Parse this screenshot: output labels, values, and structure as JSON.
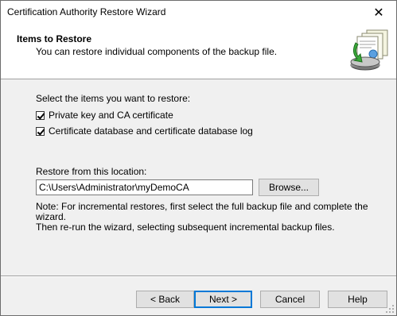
{
  "window": {
    "title": "Certification Authority Restore Wizard",
    "close_glyph": "✕"
  },
  "header": {
    "title": "Items to Restore",
    "subtitle": "You can restore individual components of the backup file.",
    "icon": "certificate-restore-icon"
  },
  "content": {
    "prompt": "Select the items you want to restore:",
    "items": [
      {
        "label": "Private key and CA certificate",
        "checked": true
      },
      {
        "label": "Certificate database and certificate database log",
        "checked": true
      }
    ],
    "location_label": "Restore from this location:",
    "location_value": "C:\\Users\\Administrator\\myDemoCA",
    "browse_label": "Browse...",
    "note_line1": "Note: For incremental restores, first select the full backup file and complete the wizard.",
    "note_line2": "Then re-run the wizard, selecting subsequent incremental backup files."
  },
  "buttons": {
    "back": "< Back",
    "next": "Next >",
    "cancel": "Cancel",
    "help": "Help"
  },
  "colors": {
    "accent": "#0078d7",
    "dialog_bg": "#f0f0f0"
  }
}
